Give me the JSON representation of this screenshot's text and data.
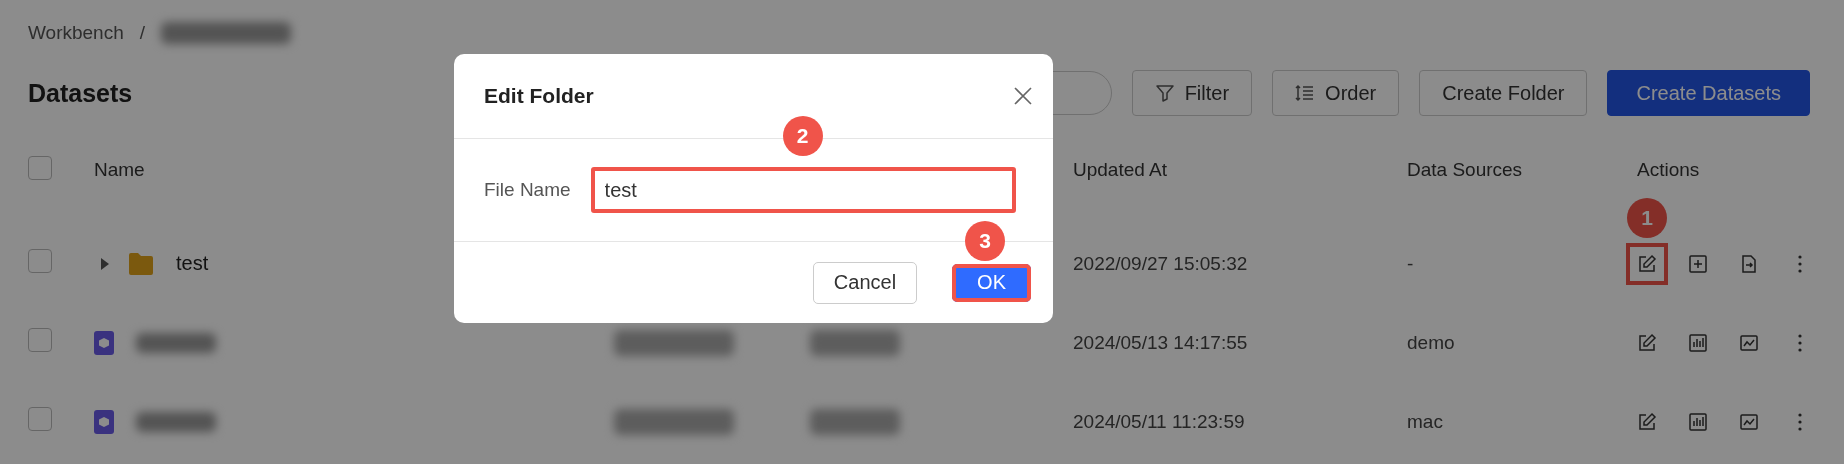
{
  "breadcrumb": {
    "root": "Workbench",
    "separator": "/",
    "current_redacted": true
  },
  "page_title": "Datasets",
  "search": {
    "kind": "search"
  },
  "toolbar": [
    {
      "label": "Filter",
      "kind": "filter"
    },
    {
      "label": "Order",
      "kind": "order"
    },
    {
      "label": "Create Folder",
      "kind": "default"
    },
    {
      "label": "Create Datasets",
      "kind": "primary"
    }
  ],
  "table": {
    "select_all": {
      "checked": false
    },
    "columns": [
      "Name",
      "Updated At",
      "Data Sources",
      "Actions"
    ],
    "rows": [
      {
        "kind": "folder",
        "name": "test",
        "redacted": false,
        "checked": false,
        "updated_at": "2022/09/27 15:05:32",
        "data_source": "-",
        "actions": [
          {
            "kind": "edit",
            "callout": "1"
          },
          {
            "kind": "add"
          },
          {
            "kind": "export"
          },
          {
            "kind": "more"
          }
        ]
      },
      {
        "kind": "dataset",
        "redacted": true,
        "checked": false,
        "updated_at": "2024/05/13 14:17:55",
        "data_source": "demo",
        "actions": [
          {
            "kind": "edit"
          },
          {
            "kind": "chart"
          },
          {
            "kind": "trend"
          },
          {
            "kind": "more"
          }
        ]
      },
      {
        "kind": "dataset",
        "redacted": true,
        "checked": false,
        "updated_at": "2024/05/11 11:23:59",
        "data_source": "mac",
        "actions": [
          {
            "kind": "edit"
          },
          {
            "kind": "chart"
          },
          {
            "kind": "trend"
          },
          {
            "kind": "more"
          }
        ]
      }
    ]
  },
  "dialog": {
    "title": "Edit Folder",
    "field": {
      "label": "File Name",
      "value": "test",
      "callout": "2"
    },
    "buttons": [
      {
        "label": "Cancel",
        "kind": "default"
      },
      {
        "label": "OK",
        "kind": "primary",
        "callout": "3"
      }
    ]
  }
}
